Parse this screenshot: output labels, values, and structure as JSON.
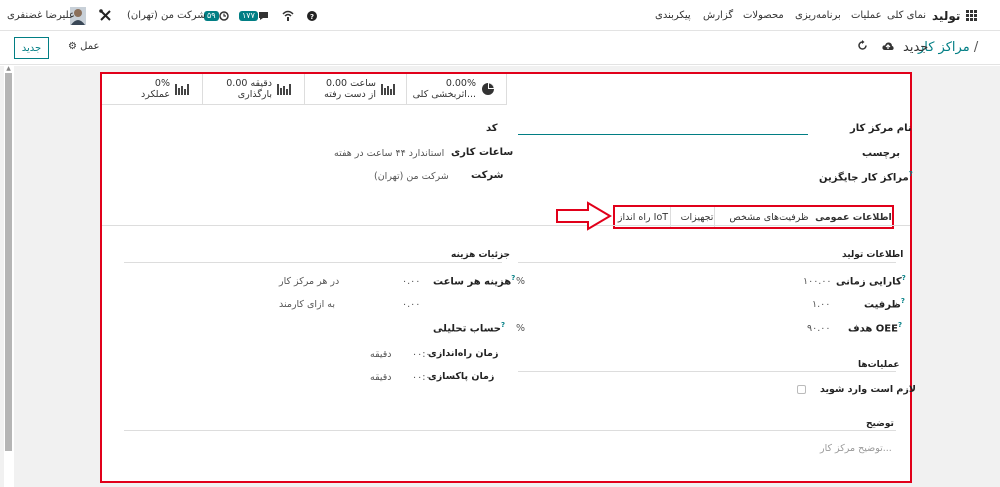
{
  "navbar": {
    "app_name": "تولید",
    "menu": [
      "نمای کلی",
      "عملیات",
      "برنامه‌ریزی",
      "محصولات",
      "گزارش",
      "پیکربندی"
    ],
    "company": "شرکت من (تهران)",
    "badge_activity": "۵۹",
    "badge_messages": "۱۷۷",
    "user_name": "علیرضا غضنفری"
  },
  "controlpanel": {
    "new_button": "جدید",
    "action_label": "عمل",
    "breadcrumb_parent": "مراکز کار",
    "breadcrumb_sep": "/",
    "breadcrumb_current": "جدید"
  },
  "smart_buttons": [
    {
      "value": "0.00%",
      "label": "اثربخشی کلی..."
    },
    {
      "value": "0.00 ساعت",
      "label": "از دست رفته"
    },
    {
      "value": "0.00 دقیقه",
      "label": "بارگذاری"
    },
    {
      "value": "0%",
      "label": "عملکرد"
    }
  ],
  "form": {
    "name_label": "نام مرکز کار",
    "tag_label": "برچسب",
    "alt_label": "مراکز کار جایگزین",
    "code_label": "کد",
    "hours_label": "ساعات کاری",
    "hours_value": "استاندارد ۴۴ ساعت در هفته",
    "company_label": "شرکت",
    "company_value": "شرکت من (تهران)"
  },
  "tabs": [
    "اطلاعات عمومی",
    "ظرفیت‌های مشخص",
    "تجهیزات",
    "راه انداز IoT"
  ],
  "production": {
    "title": "اطلاعات تولید",
    "efficiency_label": "کارایی زمانی",
    "efficiency_value": "۱۰۰.۰۰",
    "capacity_label": "ظرفیت",
    "capacity_value": "۱.۰۰",
    "oee_label": "هدف OEE",
    "oee_value": "۹۰.۰۰",
    "percent": "%"
  },
  "costing": {
    "title": "جزئیات هزینه",
    "hourly_label": "هزینه هر ساعت",
    "hourly_value": "۰.۰۰",
    "hourly_unit": "در هر مرکز کار",
    "employee_value": "۰.۰۰",
    "employee_unit": "به ازای کارمند",
    "analytic_label": "حساب تحلیلی",
    "setup_label": "زمان راه‌اندازی",
    "setup_value": "۰۰:۰۰",
    "cleanup_label": "زمان پاکسازی",
    "cleanup_value": "۰۰:۰۰",
    "minutes": "دقیقه"
  },
  "operations": {
    "title": "عملیات‌ها",
    "required_label": "لازم است وارد شوید"
  },
  "description": {
    "title": "توضیح",
    "placeholder": "توضیح مرکز کار..."
  },
  "colors": {
    "accent": "#017e84",
    "highlight": "#e1001a"
  }
}
